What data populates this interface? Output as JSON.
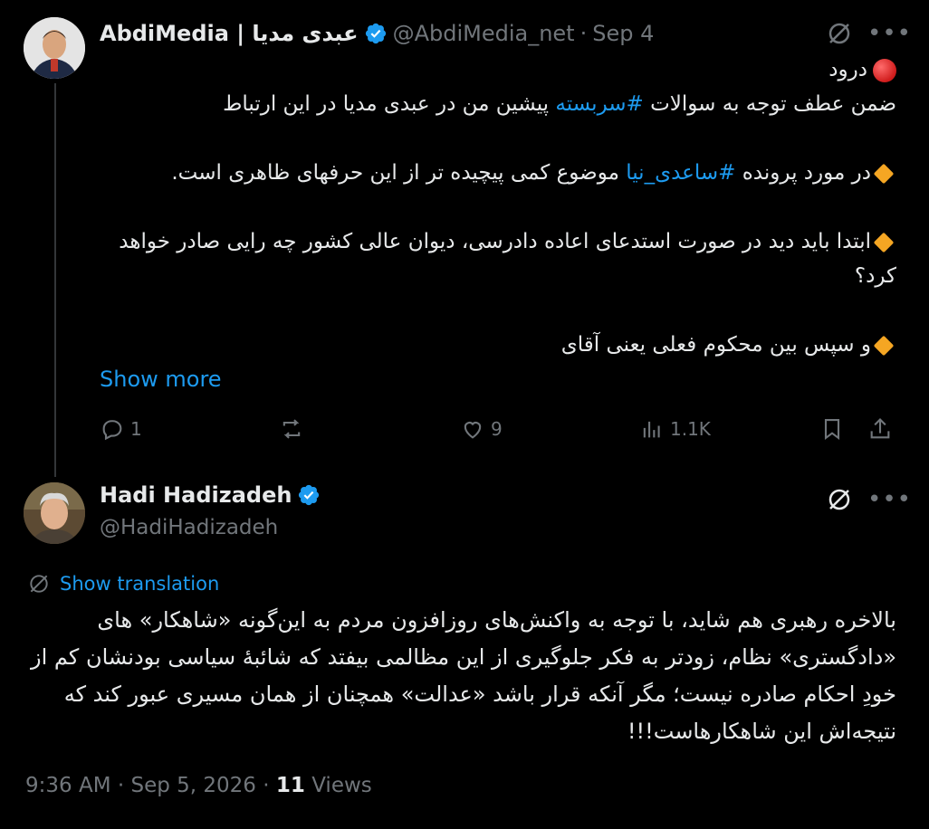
{
  "tweet1": {
    "author_name": "AbdiMedia | عبدی مدیا",
    "handle": "@AbdiMedia_net",
    "separator": "·",
    "date": "Sep 4",
    "greeting": "درود",
    "line1_pre": "ضمن عطف توجه به سوالات",
    "line1_hashtag": "#سربسته",
    "line1_post": "پیشین من در عبدی مدیا در این ارتباط",
    "line2_pre": "در مورد پرونده",
    "line2_hashtag": "#ساعدی_نیا",
    "line2_post": "موضوع کمی پیچیده تر از این حرفهای ظاهری است.",
    "line3": "ابتدا باید دید در صورت استدعای اعاده دادرسی، دیوان عالی کشور چه رایی صادر خواهد کرد؟",
    "line4": "و سپس بین محکوم فعلی یعنی آقای",
    "show_more": "Show more",
    "replies": "1",
    "likes": "9",
    "views": "1.1K"
  },
  "tweet2": {
    "author_name": "Hadi Hadizadeh",
    "handle": "@HadiHadizadeh",
    "show_translation": "Show translation",
    "body": "بالاخره رهبری هم شاید، با توجه به واکنش‌های روزافزون مردم به این‌گونه «شاهکار» های «دادگستری» نظام، زودتر به فکر جلوگیری از این مظالمی بیفتد که شائبهٔ سیاسی بودنشان کم از خودِ احکام صادره نیست؛ مگر آنکه قرار باشد «عدالت» همچنان از همان مسیری عبور کند که نتیجه‌اش این شاهکارهاست!!!",
    "time": "9:36 AM",
    "separator": "·",
    "date": "Sep 5, 2026",
    "views_count": "11",
    "views_label": "Views"
  },
  "colors": {
    "background": "#000000",
    "text": "#e7e9ea",
    "muted": "#71767b",
    "accent": "#1d9bf0",
    "divider": "#333639"
  },
  "icons": [
    "verified-badge-icon",
    "grok-icon",
    "more-icon",
    "reply-icon",
    "retweet-icon",
    "like-icon",
    "views-icon",
    "bookmark-icon",
    "share-icon",
    "translate-icon",
    "red-circle-emoji",
    "orange-diamond-emoji"
  ]
}
